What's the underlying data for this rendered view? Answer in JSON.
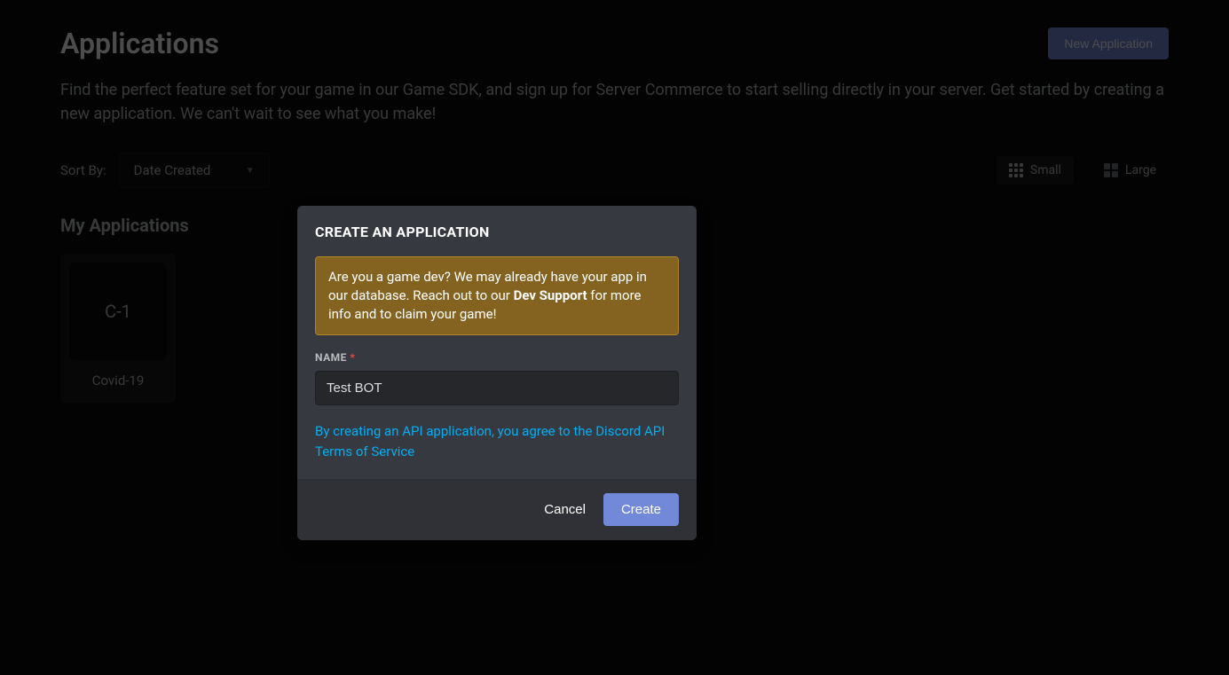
{
  "header": {
    "title": "Applications",
    "new_app_label": "New Application"
  },
  "description": "Find the perfect feature set for your game in our Game SDK, and sign up for Server Commerce to start selling directly in your server. Get started by creating a new application. We can't wait to see what you make!",
  "sort": {
    "label": "Sort By:",
    "selected": "Date Created"
  },
  "view": {
    "small_label": "Small",
    "large_label": "Large"
  },
  "section_title": "My Applications",
  "apps": [
    {
      "initials": "C-1",
      "name": "Covid-19"
    }
  ],
  "modal": {
    "title": "CREATE AN APPLICATION",
    "banner_pre": "Are you a game dev? We may already have your app in our database. Reach out to our ",
    "banner_bold": "Dev Support",
    "banner_post": " for more info and to claim your game!",
    "name_label": "NAME",
    "required_mark": "*",
    "name_value": "Test BOT",
    "tos_text": "By creating an API application, you agree to the Discord API Terms of Service",
    "cancel_label": "Cancel",
    "create_label": "Create"
  }
}
